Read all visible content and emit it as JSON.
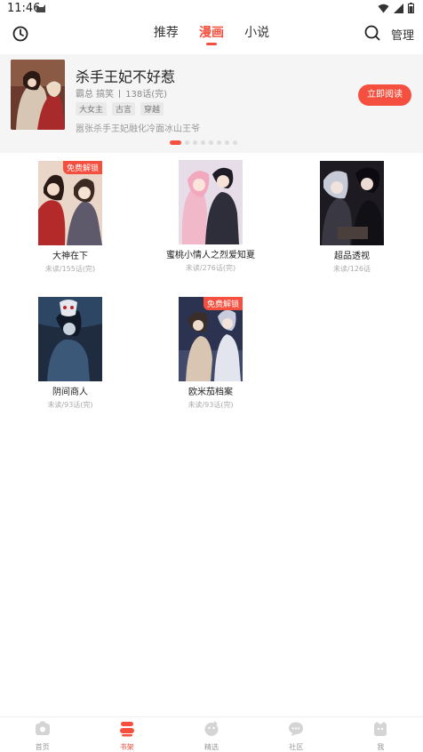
{
  "status_bar": {
    "time": "11:46"
  },
  "header": {
    "tabs": [
      {
        "label": "推荐",
        "active": false
      },
      {
        "label": "漫画",
        "active": true
      },
      {
        "label": "小说",
        "active": false
      }
    ],
    "manage_label": "管理"
  },
  "banner": {
    "title": "杀手王妃不好惹",
    "genres": "霸总 搞笑",
    "chapters": "138话(完)",
    "tags": [
      "大女主",
      "古言",
      "穿越"
    ],
    "description": "嚣张杀手王妃融化冷面冰山王爷",
    "read_button": "立即阅读",
    "page_count": 8,
    "active_page": 0
  },
  "books": [
    {
      "title": "大神在下",
      "progress": "未读/155话(完)",
      "badge": "免费解锁"
    },
    {
      "title": "蜜桃小情人之烈爱知夏",
      "progress": "未读/276话(完)",
      "badge": ""
    },
    {
      "title": "超品透视",
      "progress": "未读/126话",
      "badge": ""
    },
    {
      "title": "阴间商人",
      "progress": "未读/93话(完)",
      "badge": ""
    },
    {
      "title": "欧米茄档案",
      "progress": "未读/93话(完)",
      "badge": "免费解锁"
    }
  ],
  "bottom_nav": [
    {
      "label": "首页",
      "icon": "home-icon",
      "active": false
    },
    {
      "label": "书架",
      "icon": "bookshelf-icon",
      "active": true
    },
    {
      "label": "精选",
      "icon": "featured-icon",
      "active": false
    },
    {
      "label": "社区",
      "icon": "community-icon",
      "active": false
    },
    {
      "label": "我",
      "icon": "profile-icon",
      "active": false
    }
  ],
  "colors": {
    "accent": "#f5503f"
  }
}
